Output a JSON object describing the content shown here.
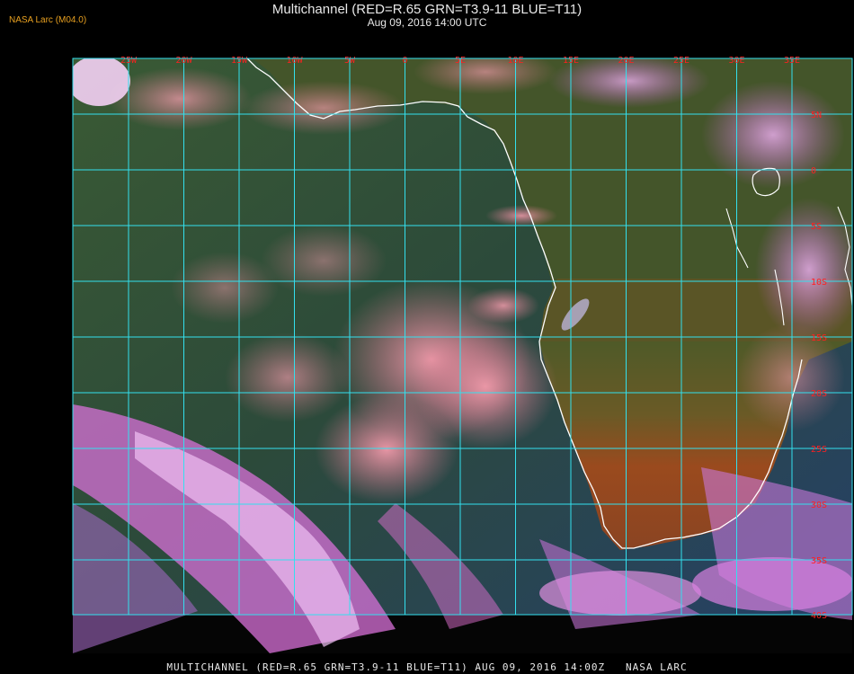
{
  "header": {
    "title": "Multichannel (RED=R.65 GRN=T3.9-11 BLUE=T11)",
    "datetime": "Aug 09, 2016 14:00 UTC"
  },
  "product_label": "NASA Larc (M04.0)",
  "footer": {
    "caption": "MULTICHANNEL (RED=R.65 GRN=T3.9-11 BLUE=T11) AUG 09, 2016 14:00Z   NASA LARC"
  },
  "colors": {
    "gridline": "#33e0ee",
    "grid_label": "#ff2020",
    "coastline": "#ffffff",
    "ocean": "#2b4360",
    "land_desert": "#9a4a20",
    "land_forest": "#4a5a2a",
    "cloud_pink": "#e67e9a",
    "cloud_magenta": "#e070e0"
  },
  "map": {
    "longitude_labels": [
      "25W",
      "20W",
      "15W",
      "10W",
      "5W",
      "0",
      "5E",
      "10E",
      "15E",
      "20E",
      "25E",
      "30E",
      "35E"
    ],
    "latitude_labels": [
      "5N",
      "0",
      "5S",
      "10S",
      "15S",
      "20S",
      "25S",
      "30S",
      "35S",
      "40S"
    ]
  }
}
